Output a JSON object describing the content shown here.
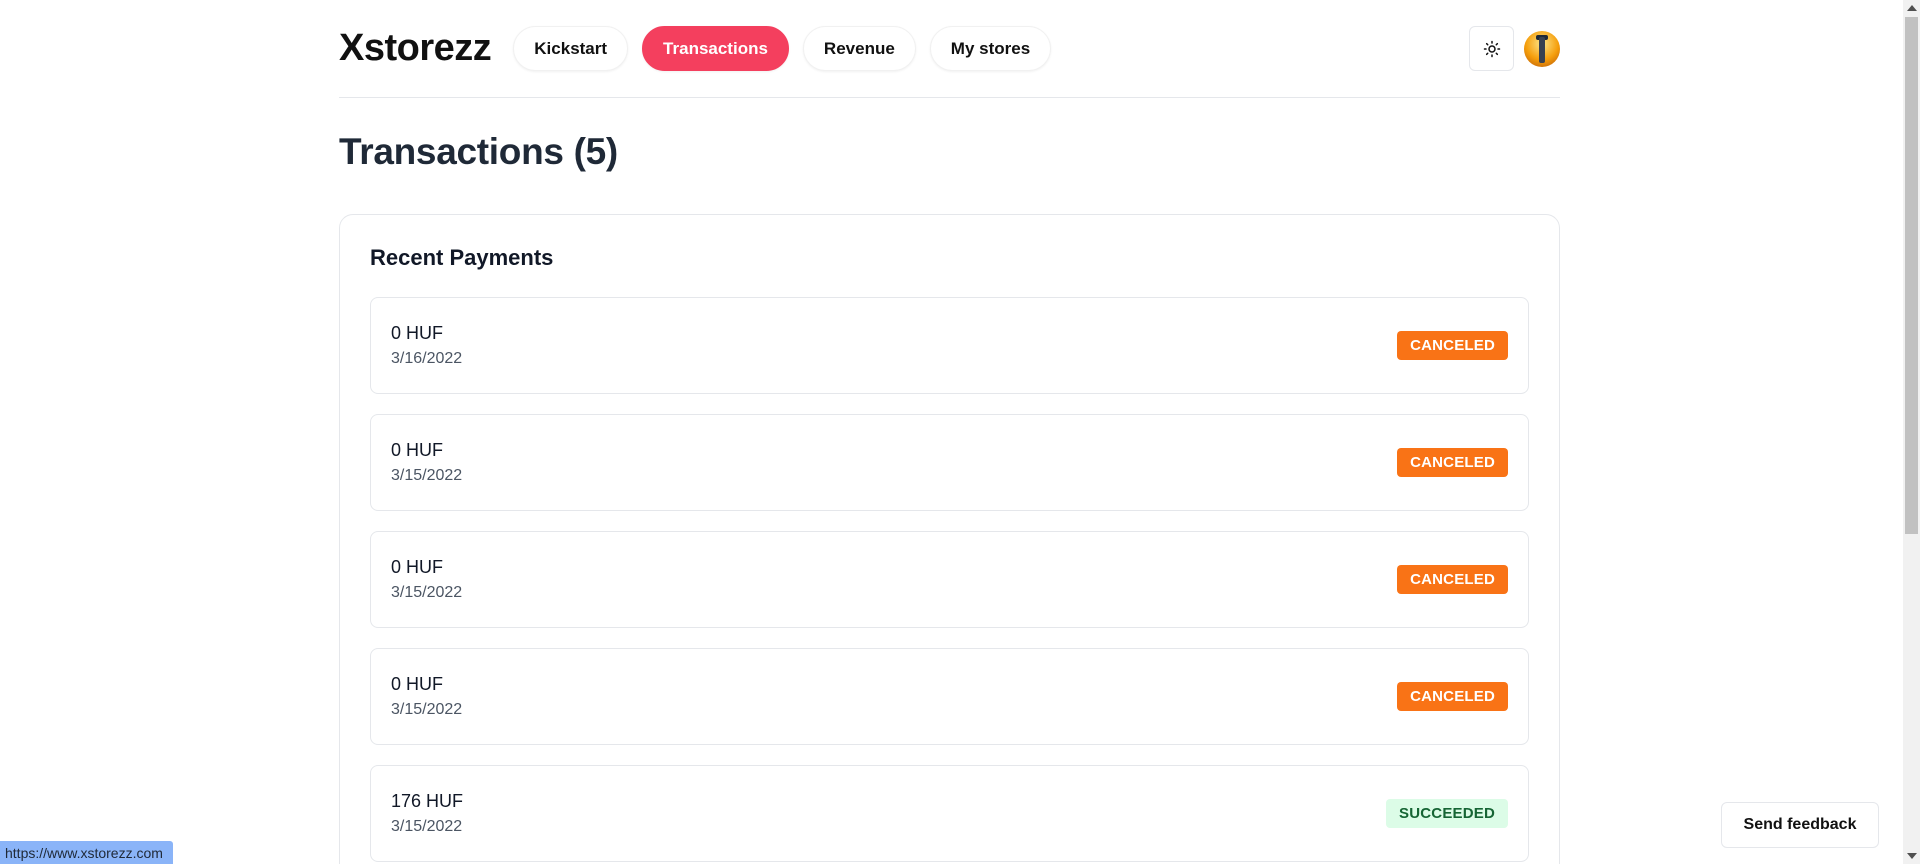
{
  "header": {
    "logo": "Xstorezz",
    "nav": [
      {
        "label": "Kickstart",
        "active": false
      },
      {
        "label": "Transactions",
        "active": true
      },
      {
        "label": "Revenue",
        "active": false
      },
      {
        "label": "My stores",
        "active": false
      }
    ],
    "theme_icon": "sun-icon",
    "avatar_icon": "lighthouse-avatar"
  },
  "page": {
    "title": "Transactions (5)"
  },
  "card": {
    "title": "Recent Payments",
    "payments": [
      {
        "amount": "0 HUF",
        "date": "3/16/2022",
        "status": "CANCELED",
        "status_color": "#f97316"
      },
      {
        "amount": "0 HUF",
        "date": "3/15/2022",
        "status": "CANCELED",
        "status_color": "#f97316"
      },
      {
        "amount": "0 HUF",
        "date": "3/15/2022",
        "status": "CANCELED",
        "status_color": "#f97316"
      },
      {
        "amount": "0 HUF",
        "date": "3/15/2022",
        "status": "CANCELED",
        "status_color": "#f97316"
      },
      {
        "amount": "176 HUF",
        "date": "3/15/2022",
        "status": "SUCCEEDED",
        "status_color": "#dcfce7"
      }
    ]
  },
  "feedback": {
    "label": "Send feedback"
  },
  "status_url": "https://www.xstorezz.com",
  "colors": {
    "accent": "#f43f5e",
    "canceled": "#f97316",
    "succeeded_bg": "#dcfce7",
    "succeeded_text": "#166534"
  }
}
